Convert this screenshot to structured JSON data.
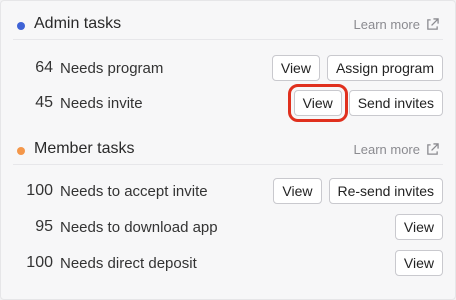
{
  "sections": [
    {
      "title": "Admin tasks",
      "dot_color": "#3f63d6",
      "learn_more": "Learn more",
      "rows": [
        {
          "count": "64",
          "label": "Needs program",
          "buttons": [
            "View",
            "Assign program"
          ]
        },
        {
          "count": "45",
          "label": "Needs invite",
          "buttons": [
            "View",
            "Send invites"
          ]
        }
      ]
    },
    {
      "title": "Member tasks",
      "dot_color": "#f4974a",
      "learn_more": "Learn more",
      "rows": [
        {
          "count": "100",
          "label": "Needs to accept invite",
          "buttons": [
            "View",
            "Re-send invites"
          ]
        },
        {
          "count": "95",
          "label": "Needs to download app",
          "buttons": [
            "View"
          ]
        },
        {
          "count": "100",
          "label": "Needs direct deposit",
          "buttons": [
            "View"
          ]
        }
      ]
    }
  ],
  "highlighted": "Needs invite View button",
  "accent_red": "#e0301e"
}
